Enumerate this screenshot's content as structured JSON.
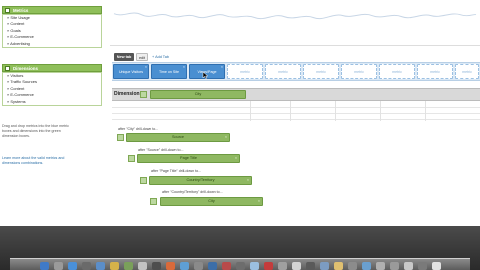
{
  "metrics_panel": {
    "title": "Metrics",
    "items": [
      "» Site Usage",
      "» Content",
      "» Goals",
      "» E-Commerce",
      "» Advertising"
    ]
  },
  "dimensions_panel": {
    "title": "Dimensions",
    "items": [
      "» Visitors",
      "» Traffic Sources",
      "» Content",
      "» E-Commerce",
      "» Systems"
    ]
  },
  "notes": {
    "drag": "Drag and drop metrics into the blue metric boxes and dimensions into the green dimension boxes.",
    "learn": "Learn more about the valid metrics and dimensions combinations."
  },
  "tabs": {
    "active": "New tab",
    "second": "edit",
    "add": "+ Add Tab"
  },
  "metric_tiles": [
    {
      "label": "Unique Visitors",
      "filled": true
    },
    {
      "label": "Time on Site",
      "filled": true
    },
    {
      "label": "Views/Page",
      "filled": true
    },
    {
      "label": "metric",
      "filled": false
    },
    {
      "label": "metric",
      "filled": false
    },
    {
      "label": "metric",
      "filled": false
    },
    {
      "label": "metric",
      "filled": false
    },
    {
      "label": "metric",
      "filled": false
    },
    {
      "label": "metric",
      "filled": false
    },
    {
      "label": "metric",
      "filled": false
    }
  ],
  "dimension_row": {
    "label": "Dimension:",
    "chip": "City"
  },
  "drilldown": [
    {
      "caption": "after \"City\" drill-down to...",
      "chip": "Source"
    },
    {
      "caption": "after \"Source\" drill-down to...",
      "chip": "Page Title"
    },
    {
      "caption": "after \"Page Title\" drill-down to...",
      "chip": "Country/Territory"
    },
    {
      "caption": "after \"Country/Territory\" drill-down to...",
      "chip": "City"
    }
  ],
  "colors": {
    "metric_blue": "#4a8fd1",
    "dimension_green": "#8fb862",
    "panel_green": "#8fbf5a"
  }
}
